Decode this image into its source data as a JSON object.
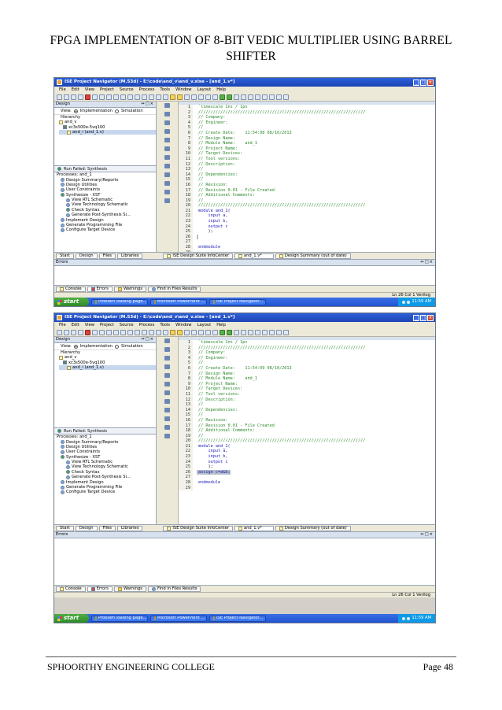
{
  "doc": {
    "title": "FPGA IMPLEMENTATION  OF 8-BIT VEDIC MULTIPLIER USING BARREL SHIFTER",
    "footer_left": "SPHOORTHY ENGINEERING COLLEGE",
    "footer_right": "Page 48"
  },
  "window": {
    "title": "ISE Project Navigator (M.53d) - E:\\code\\and_v\\and_v.xise - [and_1.v*]",
    "menu": [
      "File",
      "Edit",
      "View",
      "Project",
      "Source",
      "Process",
      "Tools",
      "Window",
      "Layout",
      "Help"
    ]
  },
  "design_panel": {
    "header": "Design",
    "view_label": "View:",
    "implementation": "Implementation",
    "simulation": "Simulation",
    "hierarchy": "Hierarchy",
    "tree": [
      "and_v",
      "xc3s500e-5vq100",
      "and_i (and_1.v)"
    ],
    "run_status": "Run Failed: Synthesis",
    "processes_label": "Processes: and_1",
    "processes": [
      "Design Summary/Reports",
      "Design Utilities",
      "User Constraints",
      "Synthesize - XST",
      "View RTL Schematic",
      "View Technology Schematic",
      "Check Syntax",
      "Generate Post-Synthesis Si...",
      "Implement Design",
      "Generate Programming File",
      "Configure Target Device"
    ],
    "tabs": [
      "Start",
      "Design",
      "Files",
      "Libraries"
    ]
  },
  "editor": {
    "tabs": [
      "ISE Design Suite InfoCenter",
      "and_1.v*",
      "Design Summary (out of date)"
    ],
    "lines1": [
      "`timescale 1ns / 1ps",
      "////////////////////////////////////////////////////////////////////",
      "// Company:",
      "// Engineer:",
      "//",
      "// Create Date:    11:54:08 08/10/2013",
      "// Design Name:",
      "// Module Name:    and_1",
      "// Project Name:",
      "// Target Devices:",
      "// Tool versions:",
      "// Description:",
      "//",
      "// Dependencies:",
      "//",
      "// Revision:",
      "// Revision 0.01 - File Created",
      "// Additional Comments:",
      "//",
      "////////////////////////////////////////////////////////////////////",
      "module and_1(",
      "    input a,",
      "    input b,",
      "    output c",
      "    );",
      "",
      "",
      "endmodule",
      ""
    ],
    "lines2": [
      "`timescale 1ns / 1ps",
      "////////////////////////////////////////////////////////////////////",
      "// Company:",
      "// Engineer:",
      "//",
      "// Create Date:    11:54:09 08/10/2013",
      "// Design Name:",
      "// Module Name:    and_1",
      "// Project Name:",
      "// Target Devices:",
      "// Tool versions:",
      "// Description:",
      "//",
      "// Dependencies:",
      "//",
      "// Revision:",
      "// Revision 0.01 - File Created",
      "// Additional Comments:",
      "//",
      "////////////////////////////////////////////////////////////////////",
      "module and_1(",
      "    input a,",
      "    input b,",
      "    output c",
      "    );",
      "assign c=a&b;",
      "",
      "endmodule",
      ""
    ]
  },
  "errors": {
    "header": "Errors",
    "tabs": [
      "Console",
      "Errors",
      "Warnings",
      "Find in Files Results"
    ]
  },
  "status": {
    "position": "Ln 26 Col 1   Verilog"
  },
  "taskbar": {
    "start": "start",
    "tasks": [
      "Problem loading page...",
      "Microsoft PowerPoint ...",
      "ISE Project Navigator..."
    ],
    "clock": "11:59 AM"
  }
}
